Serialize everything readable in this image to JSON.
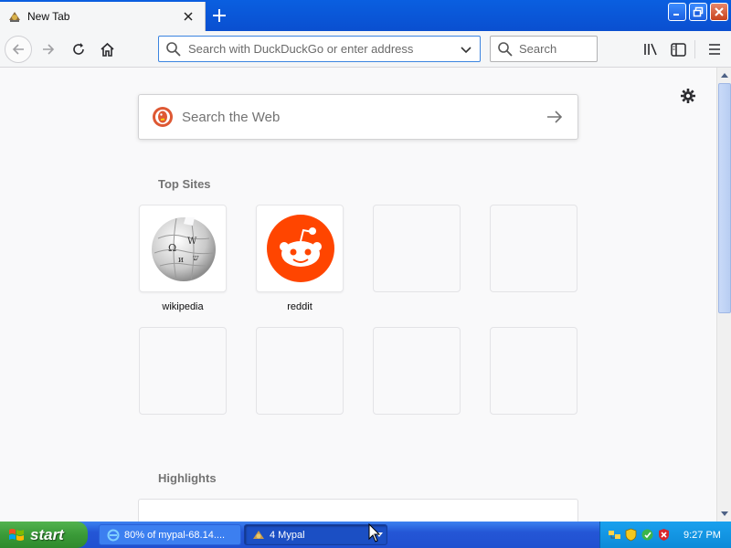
{
  "tab": {
    "title": "New Tab"
  },
  "navbar": {
    "url_placeholder": "Search with DuckDuckGo or enter address",
    "search_placeholder": "Search"
  },
  "content": {
    "web_search_placeholder": "Search the Web",
    "top_sites_title": "Top Sites",
    "highlights_title": "Highlights",
    "top_sites": [
      {
        "label": "wikipedia",
        "icon": "wikipedia-globe-icon"
      },
      {
        "label": "reddit",
        "icon": "reddit-icon"
      }
    ]
  },
  "taskbar": {
    "start_label": "start",
    "tasks": [
      {
        "label": "80% of mypal-68.14....",
        "icon": "ie-icon"
      },
      {
        "label": "4 Mypal",
        "icon": "mypal-icon"
      }
    ],
    "clock": "9:27 PM"
  },
  "colors": {
    "accent_blue": "#0a5fe0",
    "reddit_orange": "#ff4500",
    "ddg_orange": "#de5833",
    "start_green": "#3a9a38"
  }
}
